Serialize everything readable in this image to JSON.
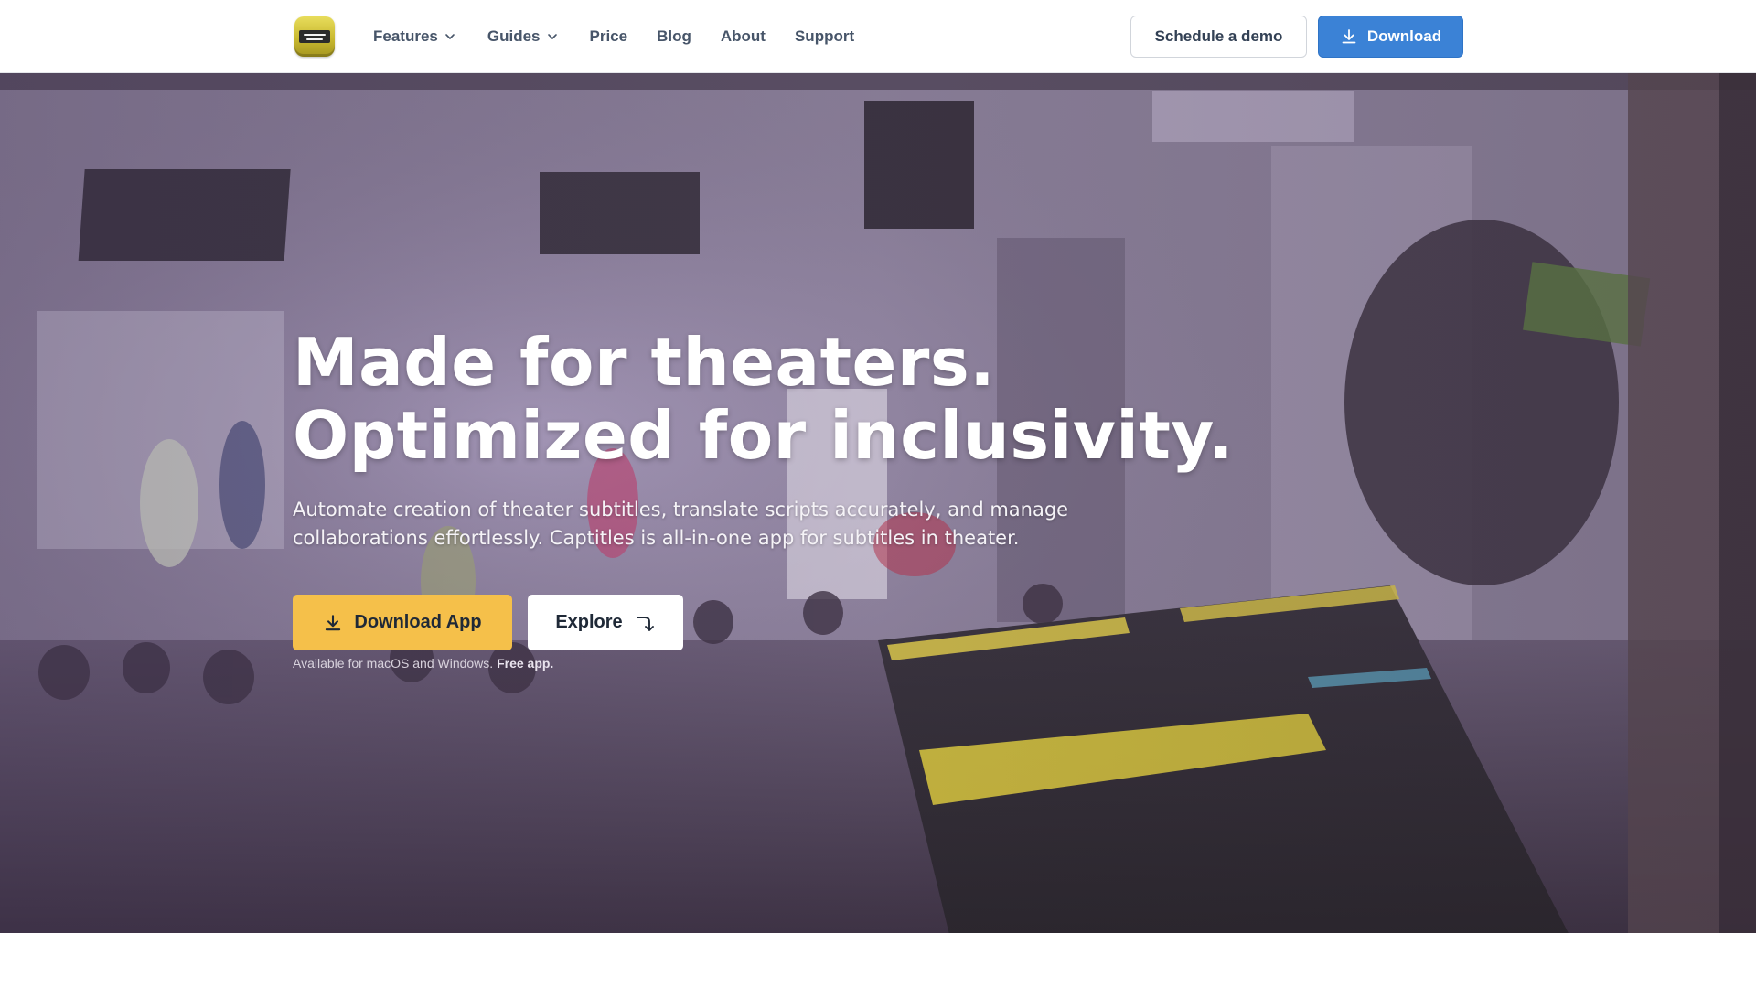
{
  "nav": {
    "logo_icon": "captitles-logo",
    "items": [
      {
        "label": "Features",
        "has_dropdown": true
      },
      {
        "label": "Guides",
        "has_dropdown": true
      },
      {
        "label": "Price",
        "has_dropdown": false
      },
      {
        "label": "Blog",
        "has_dropdown": false
      },
      {
        "label": "About",
        "has_dropdown": false
      },
      {
        "label": "Support",
        "has_dropdown": false
      }
    ],
    "demo_label": "Schedule a demo",
    "download_label": "Download"
  },
  "hero": {
    "title_line1": "Made for theaters.",
    "title_line2": "Optimized for inclusivity.",
    "subtitle": "Automate creation of theater subtitles, translate scripts accurately, and manage collaborations effortlessly. Captitles is all-in-one app for subtitles in theater.",
    "download_app_label": "Download App",
    "explore_label": "Explore",
    "note_text": "Available for macOS and Windows.",
    "note_bold": "Free app."
  },
  "colors": {
    "primary_blue": "#3b82d6",
    "accent_yellow": "#f5c04a",
    "nav_text": "#475569"
  }
}
